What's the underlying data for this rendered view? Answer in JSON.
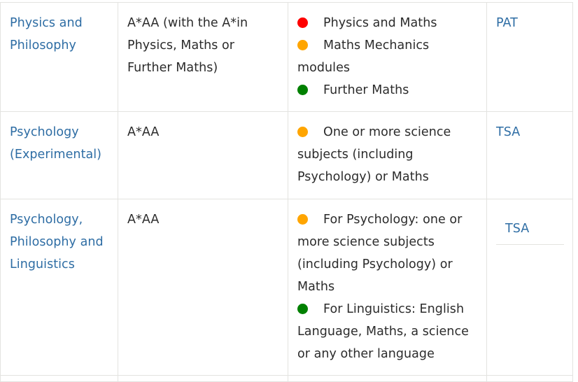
{
  "table": {
    "colors": {
      "link": "#2e6da4",
      "border": "#e3e3e0",
      "text": "#2b2b2b",
      "bullet_red": "#fe0000",
      "bullet_orange": "#ffa500",
      "bullet_green": "#008000"
    },
    "rows": [
      {
        "course": "Physics and Philosophy",
        "grades": "A*AA (with the A*in Physics, Maths or Further Maths)",
        "subjects": [
          {
            "bullet": "red-dot-icon",
            "color": "red",
            "text": "Physics and Maths"
          },
          {
            "bullet": "orange-dot-icon",
            "color": "orange",
            "text": "Maths Mechanics modules"
          },
          {
            "bullet": "green-dot-icon",
            "color": "green",
            "text": "Further Maths"
          }
        ],
        "test": "PAT"
      },
      {
        "course": "Psychology (Experimental)",
        "grades": "A*AA",
        "subjects": [
          {
            "bullet": "orange-dot-icon",
            "color": "orange",
            "text": "One or more science subjects (including Psychology) or Maths"
          }
        ],
        "test": "TSA"
      },
      {
        "course": "Psychology, Philosophy and Linguistics",
        "grades": "A*AA",
        "subjects": [
          {
            "bullet": "orange-dot-icon",
            "color": "orange",
            "text": "For Psychology: one or more science subjects (including Psychology) or Maths"
          },
          {
            "bullet": "green-dot-icon",
            "color": "green",
            "text": "For Linguistics: English Language, Maths, a science or any other language"
          }
        ],
        "test": "TSA"
      }
    ]
  }
}
